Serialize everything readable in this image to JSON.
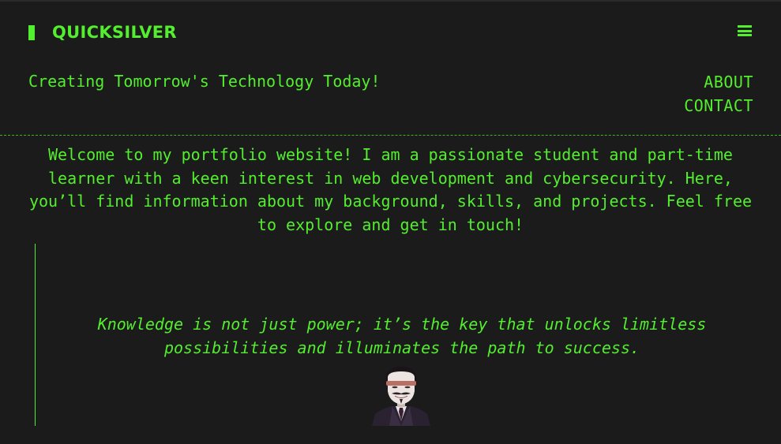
{
  "header": {
    "brand": "QUICKSILVER",
    "tagline": "Creating Tomorrow's Technology Today!",
    "menu_icon": "hamburger-menu-icon"
  },
  "nav": {
    "items": [
      {
        "label": "ABOUT"
      },
      {
        "label": "CONTACT"
      }
    ]
  },
  "main": {
    "intro_lines": [
      "Welcome to my portfolio website! I am a passionate student and part-time",
      "learner with a keen interest in web development and cybersecurity. Here,",
      "you’ll find information about my background, skills, and projects. Feel free",
      "to explore and get in touch!"
    ],
    "quote_lines": [
      "Knowledge is not just power; it’s the key that unlocks limitless",
      "possibilities and illuminates the path to success."
    ],
    "avatar": "guy-fawkes-mask-avatar"
  },
  "colors": {
    "background": "#1b1b1b",
    "accent": "#53ee2e"
  }
}
